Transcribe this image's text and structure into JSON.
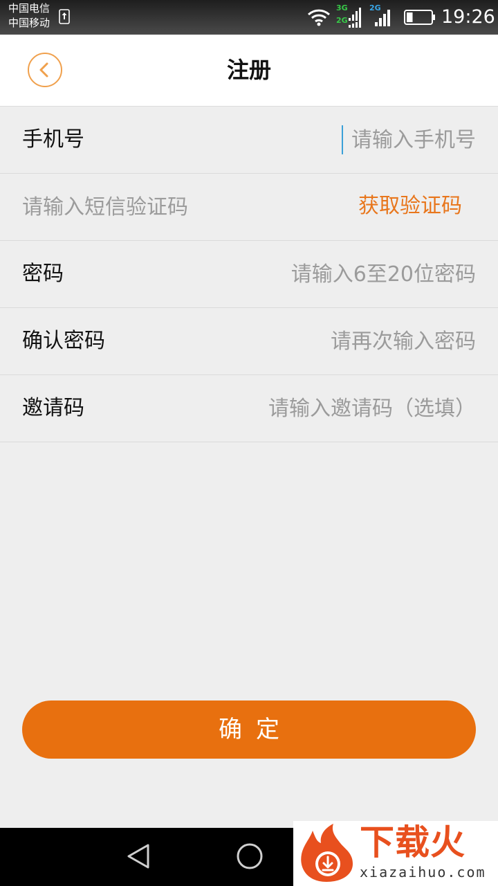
{
  "status_bar": {
    "carrier_1": "中国电信",
    "carrier_2": "中国移动",
    "network_1_top": "3G",
    "network_1_bottom": "2G",
    "network_2": "2G",
    "time": "19:26",
    "battery_level": 0.25,
    "icons": [
      "upload-icon",
      "wifi-icon",
      "signal-icon",
      "battery-icon"
    ]
  },
  "header": {
    "title": "注册",
    "back_icon": "chevron-left-icon"
  },
  "form": {
    "phone": {
      "label": "手机号",
      "placeholder": "请输入手机号",
      "value": ""
    },
    "sms": {
      "placeholder": "请输入短信验证码",
      "value": "",
      "get_code_label": "获取验证码"
    },
    "password": {
      "label": "密码",
      "placeholder": "请输入6至20位密码",
      "value": ""
    },
    "confirm_password": {
      "label": "确认密码",
      "placeholder": "请再次输入密码",
      "value": ""
    },
    "invite_code": {
      "label": "邀请码",
      "placeholder": "请输入邀请码（选填）",
      "value": ""
    }
  },
  "actions": {
    "confirm_label": "确定"
  },
  "nav_bar": {
    "icons": [
      "back-triangle-icon",
      "home-circle-icon"
    ]
  },
  "watermark": {
    "title": "下载火",
    "domain": "xiazaihuo.com"
  },
  "colors": {
    "accent": "#e8700f",
    "link": "#e8761c",
    "back_border": "#f0a04c",
    "background": "#eeeeee",
    "caret": "#3aa0d8"
  }
}
